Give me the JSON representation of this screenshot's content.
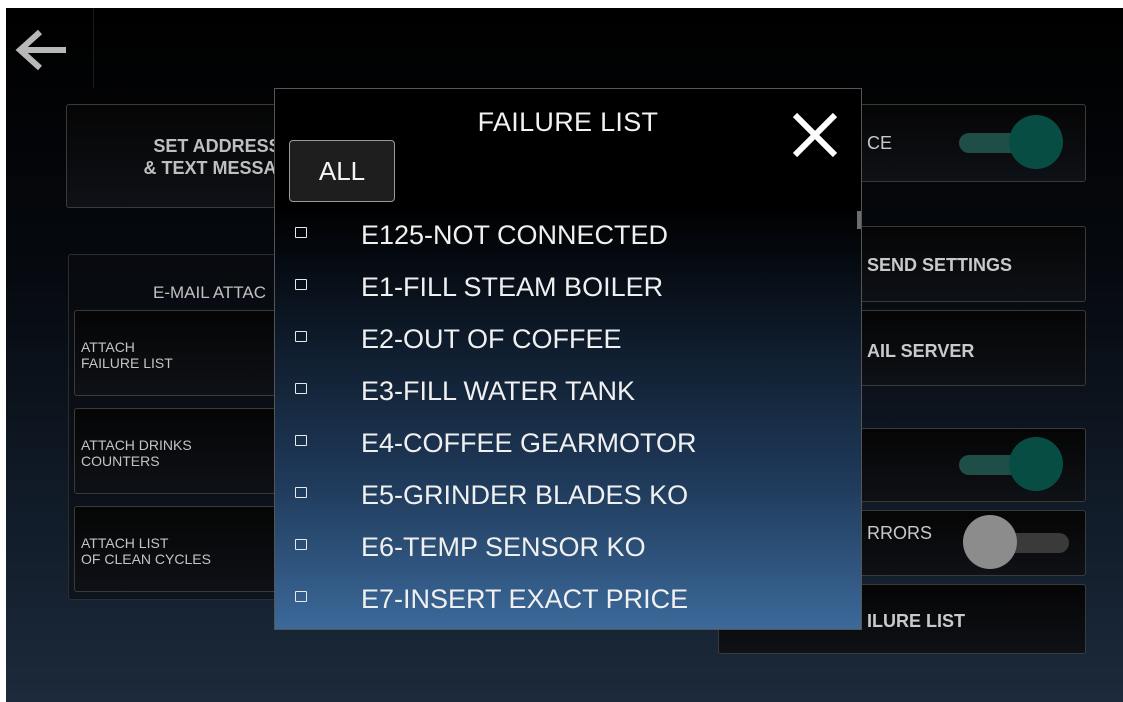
{
  "back_button": {
    "icon": "arrow-left-icon"
  },
  "left_panel": {
    "set_address": {
      "line1": "SET ADDRESS",
      "line2": "& TEXT MESSAG"
    },
    "email_group_title": "E-MAIL ATTAC",
    "attach_items": [
      {
        "line1": "ATTACH",
        "line2": "FAILURE LIST"
      },
      {
        "line1": "ATTACH DRINKS",
        "line2": "COUNTERS"
      },
      {
        "line1": "ATTACH LIST",
        "line2": "OF CLEAN CYCLES"
      }
    ]
  },
  "right_panel": {
    "service": {
      "label": "CE",
      "toggle_on": true
    },
    "send_settings": {
      "label": "SEND SETTINGS"
    },
    "mail_server": {
      "label": "AIL SERVER"
    },
    "option_toggle": {
      "label": "",
      "toggle_on": true
    },
    "errors": {
      "label": "RRORS",
      "toggle_on": false
    },
    "failure_list": {
      "label": "ILURE LIST"
    }
  },
  "dialog": {
    "title": "FAILURE LIST",
    "all_label": "ALL",
    "close_icon": "close-icon",
    "items": [
      {
        "label": "E125-NOT CONNECTED",
        "checked": false
      },
      {
        "label": "E1-FILL STEAM BOILER",
        "checked": false
      },
      {
        "label": "E2-OUT OF COFFEE",
        "checked": false
      },
      {
        "label": "E3-FILL WATER TANK",
        "checked": false
      },
      {
        "label": "E4-COFFEE GEARMOTOR",
        "checked": false
      },
      {
        "label": "E5-GRINDER BLADES KO",
        "checked": false
      },
      {
        "label": "E6-TEMP SENSOR KO",
        "checked": false
      },
      {
        "label": "E7-INSERT EXACT PRICE",
        "checked": false
      }
    ]
  },
  "colors": {
    "toggle_on": "#084d44",
    "toggle_off": "#8c8c8c",
    "list_gradient_end": "#3c6a9b"
  }
}
